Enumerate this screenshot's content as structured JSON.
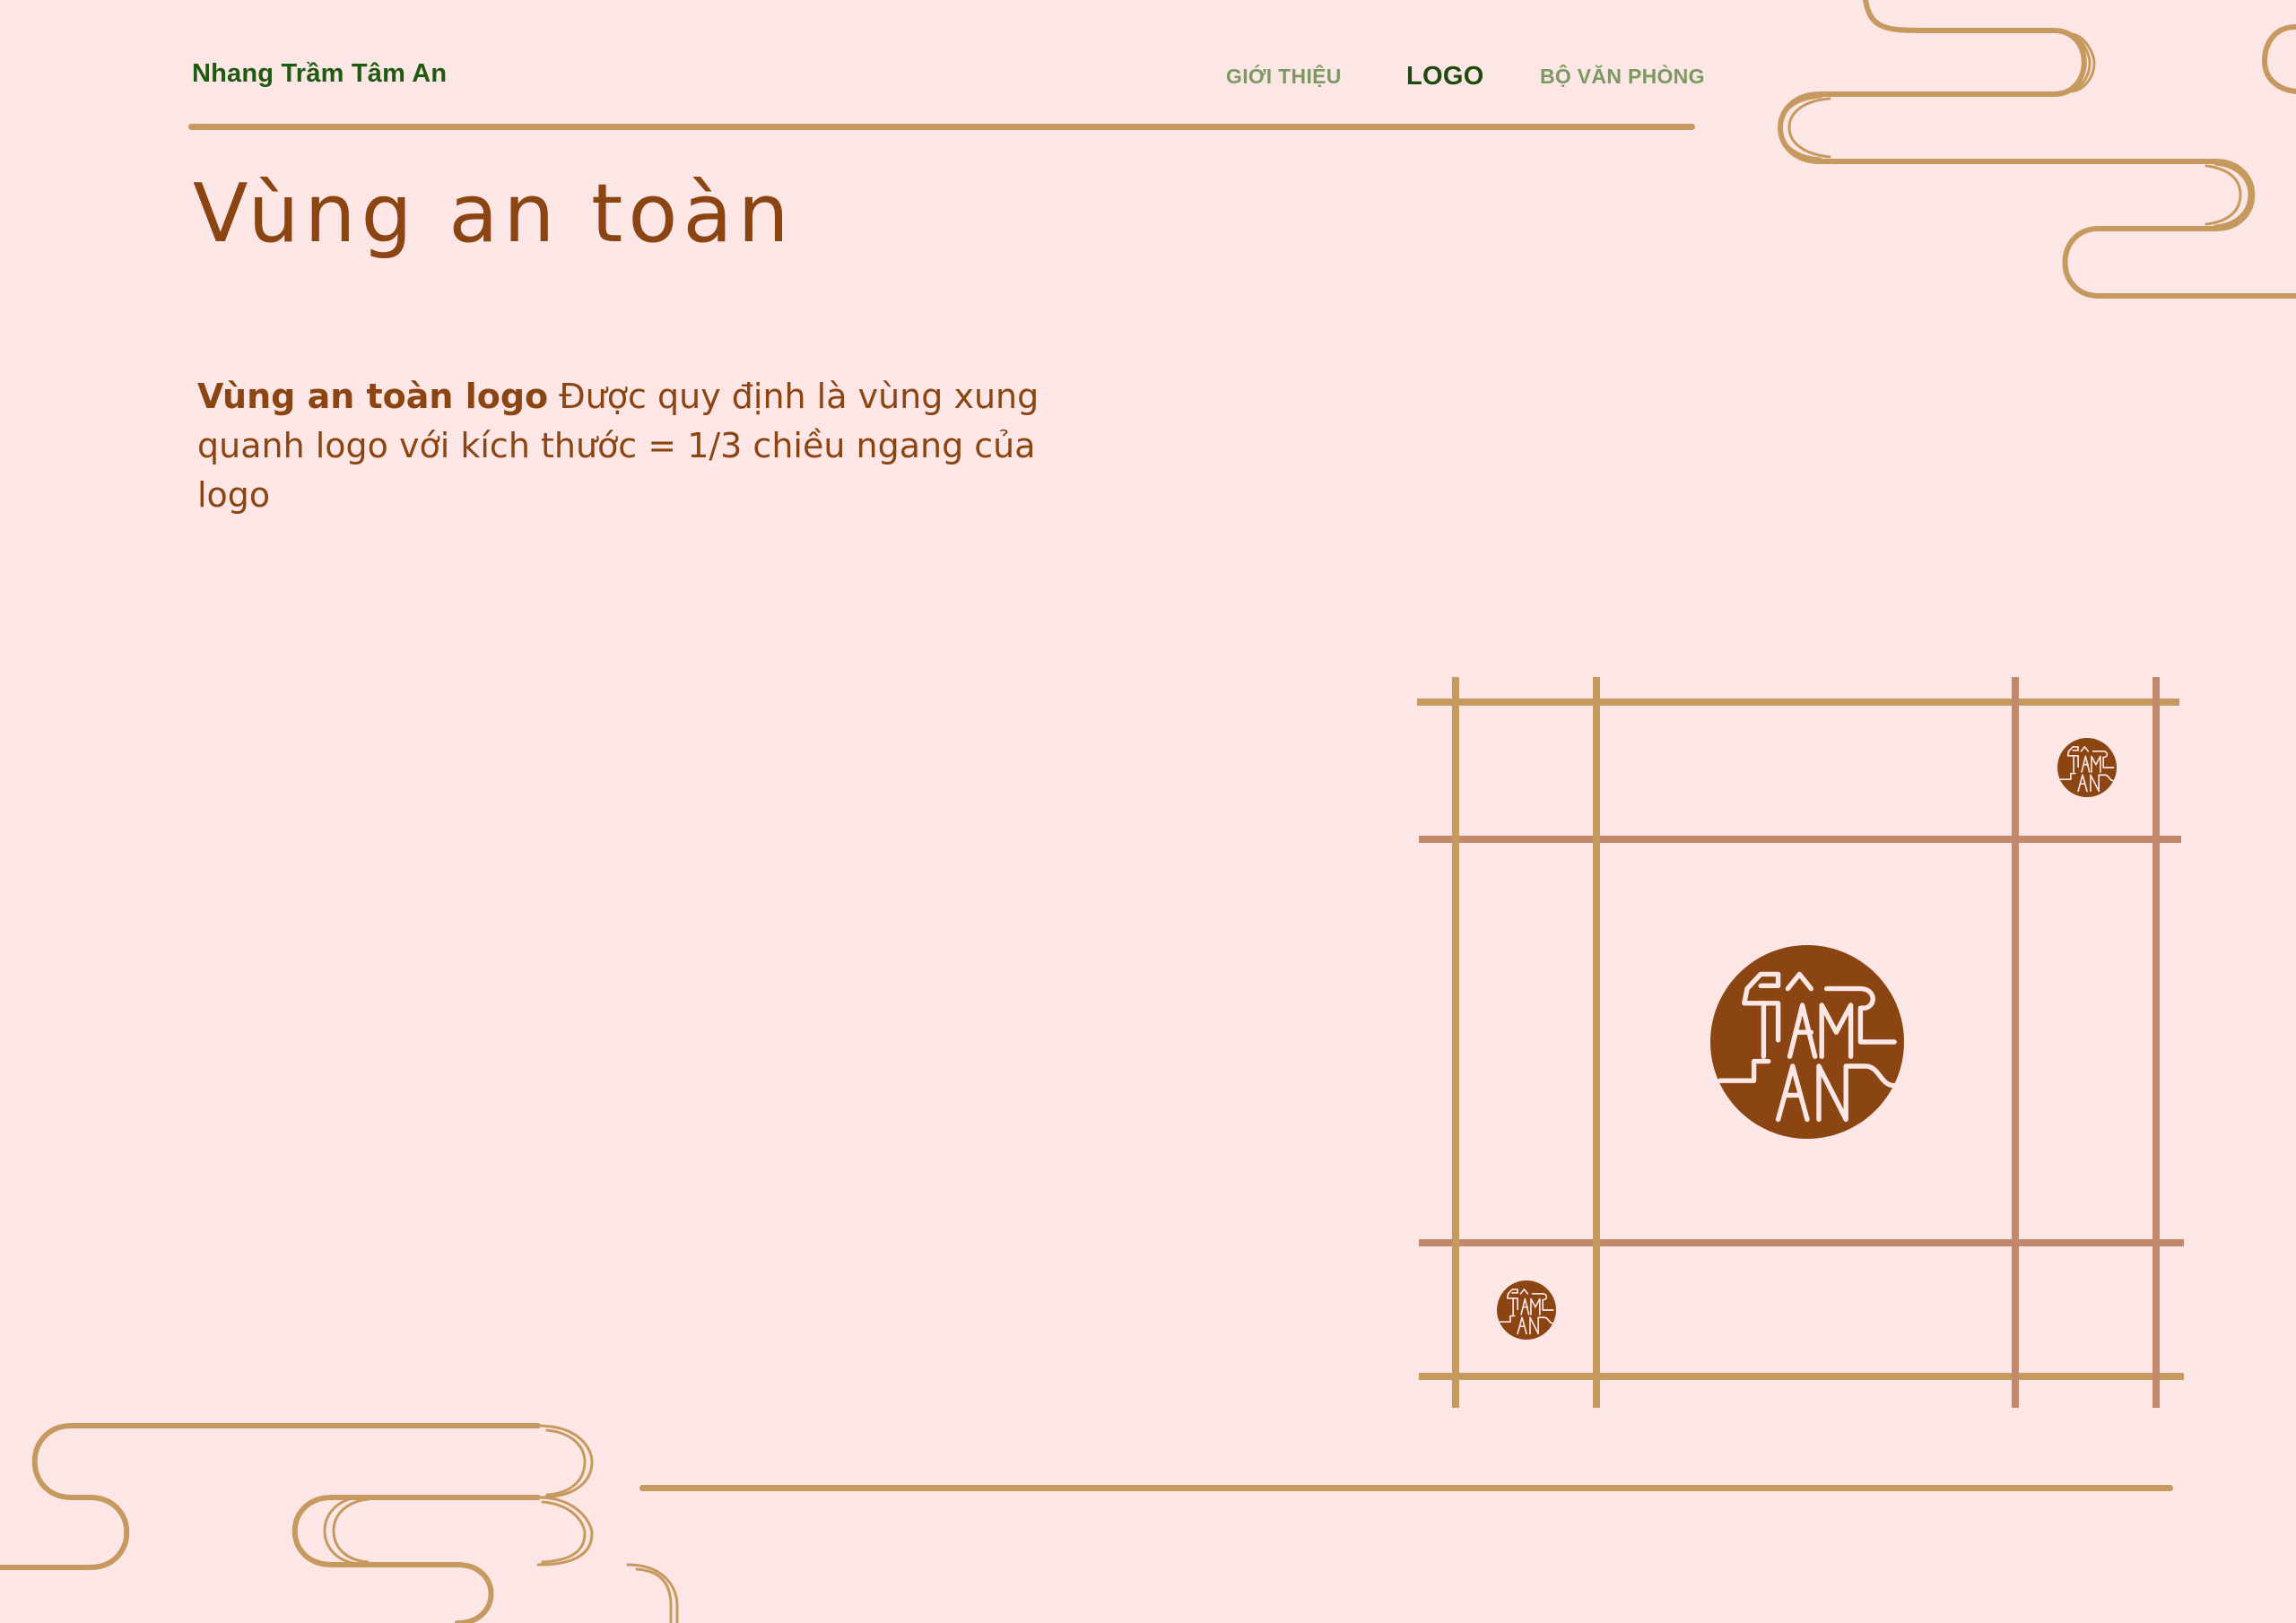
{
  "header": {
    "brand": "Nhang Trầm Tâm An",
    "nav": [
      {
        "label": "GIỚI THIỆU",
        "active": false
      },
      {
        "label": "LOGO",
        "active": true
      },
      {
        "label": "BỘ VĂN PHÒNG",
        "active": false
      }
    ]
  },
  "page": {
    "title": "Vùng an toàn",
    "description_bold": "Vùng an toàn logo",
    "description_rest": " Được quy định là vùng xung quanh logo với kích thước = 1/3 chiều ngang của logo"
  },
  "logo": {
    "line1": "TÂM",
    "line2": "AN"
  },
  "colors": {
    "background": "#fde6e6",
    "brown": "#8b4513",
    "gold": "#c69a5e",
    "green": "#1f5a10"
  }
}
